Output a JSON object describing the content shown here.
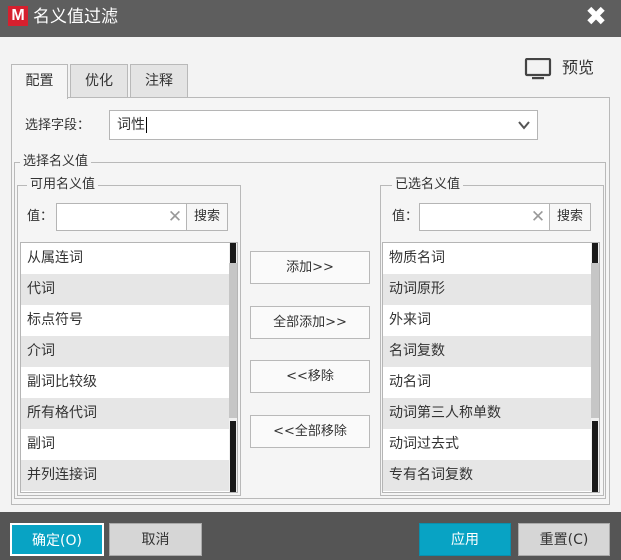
{
  "window": {
    "title": "名义值过滤",
    "logo_letter": "M",
    "close_glyph": "✖"
  },
  "preview": {
    "label": "预览",
    "icon": "monitor-icon"
  },
  "tabs": [
    {
      "label": "配置",
      "active": true
    },
    {
      "label": "优化",
      "active": false
    },
    {
      "label": "注释",
      "active": false
    }
  ],
  "field_select": {
    "label": "选择字段：",
    "value": "词性"
  },
  "nominal_group": {
    "legend": "选择名义值"
  },
  "available": {
    "legend": "可用名义值",
    "value_label": "值：",
    "search_value": "",
    "search_button": "搜索",
    "items": [
      "从属连词",
      "代词",
      "标点符号",
      "介词",
      "副词比较级",
      "所有格代词",
      "副词",
      "并列连接词"
    ]
  },
  "selected": {
    "legend": "已选名义值",
    "value_label": "值：",
    "search_value": "",
    "search_button": "搜索",
    "items": [
      "物质名词",
      "动词原形",
      "外来词",
      "名词复数",
      "动名词",
      "动词第三人称单数",
      "动词过去式",
      "专有名词复数"
    ]
  },
  "transfer_buttons": {
    "add": "添加>>",
    "add_all": "全部添加>>",
    "remove": "<<移除",
    "remove_all": "<<全部移除"
  },
  "footer": {
    "ok": "确定(O)",
    "cancel": "取消",
    "apply": "应用",
    "reset": "重置(C)"
  },
  "colors": {
    "titlebar": "#5e5e5e",
    "accent": "#08a3c4",
    "logo": "#d6202e"
  }
}
